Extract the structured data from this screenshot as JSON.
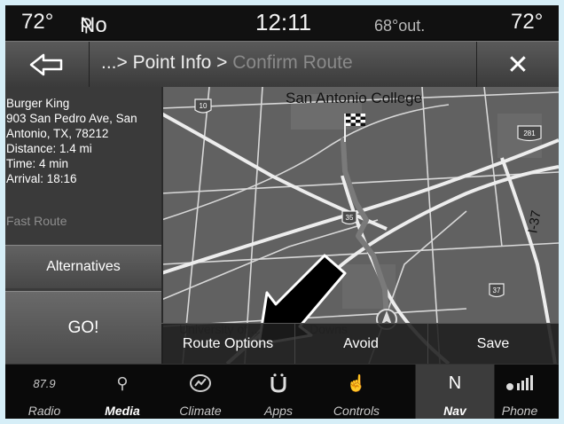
{
  "status": {
    "temp_left": "72°",
    "device": "No Device",
    "time": "12:11",
    "outside": "68°out.",
    "temp_right": "72°"
  },
  "titlebar": {
    "breadcrumb_prefix": "...> Point Info > ",
    "breadcrumb_current": "Confirm Route"
  },
  "map": {
    "landmark": "San Antonio College",
    "watermark_text": "University of ... Antonio Downs",
    "shields": [
      "10",
      "281",
      "35",
      "37"
    ],
    "road_label": "I-37"
  },
  "info": {
    "name": "Burger King",
    "address_line1": "903 San Pedro Ave, San",
    "address_line2": "Antonio, TX, 78212",
    "distance": "Distance: 1.4 mi",
    "time": "Time: 4 min",
    "arrival": "Arrival: 18:16",
    "route_type": "Fast Route",
    "alternatives_label": "Alternatives",
    "go_label": "GO!"
  },
  "options": {
    "route_options": "Route Options",
    "avoid": "Avoid",
    "save": "Save"
  },
  "dock": [
    {
      "top": "87.9",
      "label": "Radio"
    },
    {
      "top": "",
      "label": "Media"
    },
    {
      "top": "",
      "label": "Climate"
    },
    {
      "top": "",
      "label": "Apps"
    },
    {
      "top": "",
      "label": "Controls"
    },
    {
      "top": "N",
      "label": "Nav"
    },
    {
      "top": "",
      "label": "Phone"
    }
  ]
}
